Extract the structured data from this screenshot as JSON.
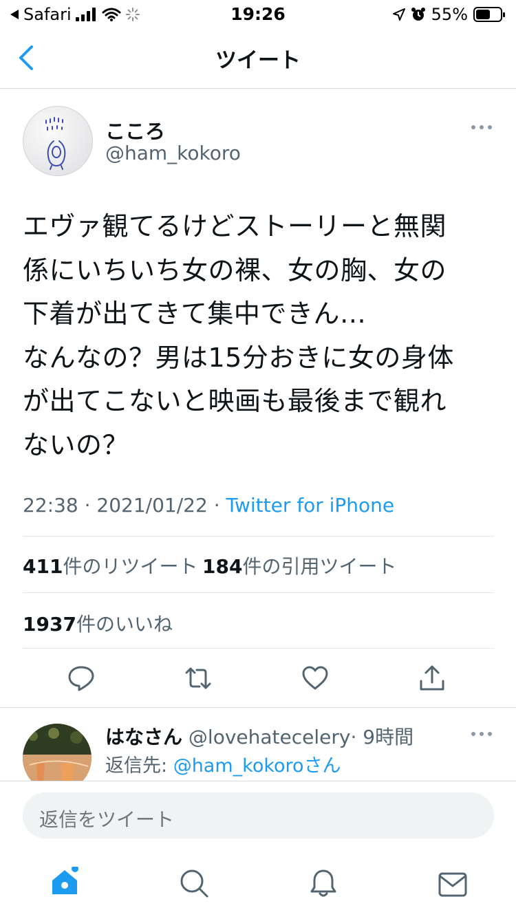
{
  "status_bar": {
    "back_app": "Safari",
    "time": "19:26",
    "battery": "55%"
  },
  "nav": {
    "title": "ツイート",
    "back_icon": "chevron-left-icon"
  },
  "tweet": {
    "display_name": "こころ",
    "handle": "@ham_kokoro",
    "text": "エヴァ観てるけどストーリーと無関\n係にいちいち女の裸、女の胸、女の\n下着が出てきて集中できん…\nなんなの？男は15分おきに女の身体\nが出てこないと映画も最後まで観れ\nないの？",
    "time": "22:38",
    "date": "2021/01/22",
    "sep": " · ",
    "source": "Twitter for iPhone"
  },
  "stats": {
    "retweets_count": "411",
    "retweets_label": "件のリツイート",
    "quotes_count": "184",
    "quotes_label": "件の引用ツイート",
    "likes_count": "1937",
    "likes_label": "件のいいね"
  },
  "reply": {
    "display_name": "はなさん",
    "handle": "@lovehatecelery",
    "time": "· 9時間",
    "reply_to_prefix": "返信先: ",
    "reply_to_handle": "@ham_kokoro",
    "reply_to_suffix": "さん"
  },
  "compose": {
    "placeholder": "返信をツイート"
  },
  "colors": {
    "accent": "#1d9bf0",
    "secondary_text": "#536471",
    "divider": "#e1e6ea"
  }
}
